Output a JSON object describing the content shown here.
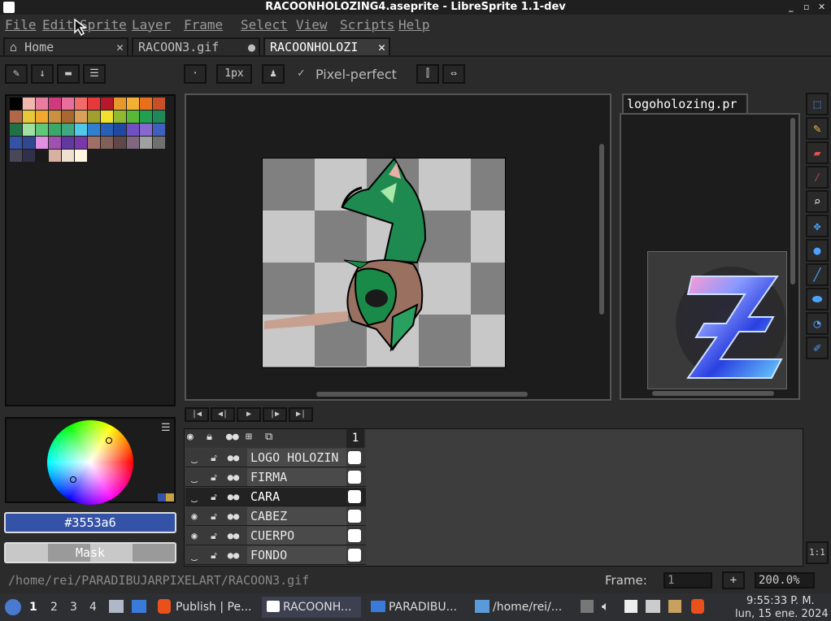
{
  "window": {
    "title": "RACOONHOLOZING4.aseprite - LibreSprite 1.1-dev",
    "buttons": [
      "_",
      "▫",
      "✕"
    ]
  },
  "menubar": [
    "File",
    "Edit",
    "Sprite",
    "Layer",
    "Frame",
    "Select",
    "View",
    "Scripts",
    "Help"
  ],
  "tabs": [
    {
      "label": "Home",
      "close": "✕"
    },
    {
      "label": "RACOON3.gif",
      "close": "●"
    },
    {
      "label": "RACOONHOLOZI",
      "close": "✕"
    }
  ],
  "toolbar": {
    "brush_size": "1px",
    "pixel_perfect_check": "✓",
    "pixel_perfect_label": "Pixel-perfect"
  },
  "palette": {
    "colors": [
      "#000000",
      "#f2b8b0",
      "#e87da0",
      "#d03a7c",
      "#e86f9c",
      "#f26b6b",
      "#e63a3a",
      "#b8182c",
      "#e8982a",
      "#f2b035",
      "#e8701c",
      "#c85028",
      "#b06848",
      "#e8c838",
      "#f0a830",
      "#c89040",
      "#a86830",
      "#d8a058",
      "#a0a030",
      "#f0e030",
      "#90b830",
      "#58b838",
      "#20a050",
      "#208858",
      "#207048",
      "#a0e0a0",
      "#60c878",
      "#3aa868",
      "#40a880",
      "#50c8e8",
      "#3080d0",
      "#2860b8",
      "#2048a0",
      "#7050c0",
      "#8868d0",
      "#4060c0",
      "#3553a6",
      "#304890",
      "#e090e0",
      "#a050b0",
      "#6038a0",
      "#7838a8",
      "#a07068",
      "#806058",
      "#604848",
      "#806880",
      "#a0a0a0",
      "#707070",
      "#484858",
      "#303048",
      "#1a1a1a",
      "#d8b0a0",
      "#f0e0d0",
      "#fff8e0"
    ]
  },
  "color_bar": {
    "hex": "#3553a6",
    "mask_label": "Mask"
  },
  "preview": {
    "tab_label": "logoholozing.pr",
    "tab_dot": "●"
  },
  "timeline": {
    "frame_number": "1",
    "layers": [
      {
        "name": "LOGO HOLOZIN",
        "visible": false,
        "selected": false
      },
      {
        "name": "FIRMA",
        "visible": false,
        "selected": false
      },
      {
        "name": "CARA",
        "visible": false,
        "selected": true
      },
      {
        "name": "CABEZ",
        "visible": true,
        "selected": false
      },
      {
        "name": "CUERPO",
        "visible": true,
        "selected": false
      },
      {
        "name": "FONDO",
        "visible": false,
        "selected": false
      }
    ],
    "zoom_reset": "1:1"
  },
  "statusbar": {
    "path": "/home/rei/PARADIBUJARPIXELART/RACOON3.gif",
    "frame_label": "Frame:",
    "frame_value": "1",
    "add": "+",
    "zoom": "200.0%"
  },
  "taskbar": {
    "workspaces": [
      "1",
      "2",
      "3",
      "4"
    ],
    "items": [
      "Publish | Pe...",
      "RACOONH...",
      "PARADIBU...",
      "/home/rei/..."
    ],
    "clock_time": "9:55:33 P. M.",
    "clock_date": "lun, 15 ene. 2024"
  },
  "colors": {
    "accent": "#3553a6",
    "bg": "#2b2b2b",
    "tool_blue": "#4aa3ff"
  }
}
